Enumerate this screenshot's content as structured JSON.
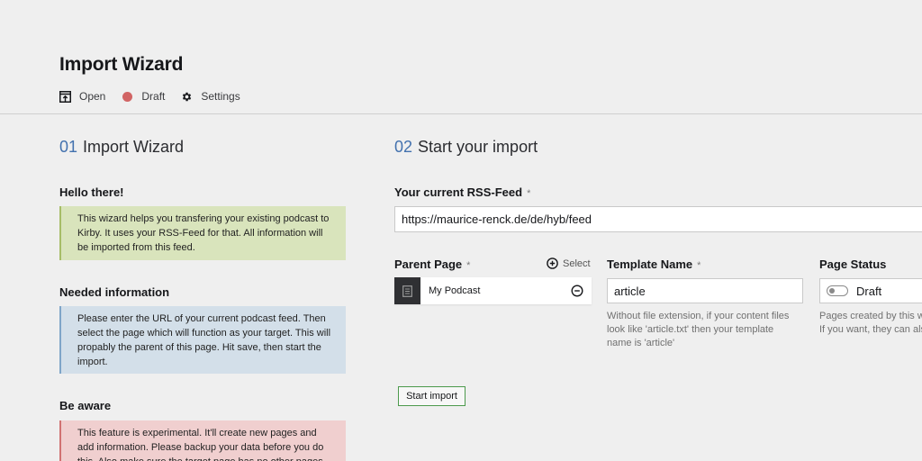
{
  "header": {
    "title": "Import Wizard",
    "toolbar": [
      {
        "label": "Open",
        "icon": "open-icon"
      },
      {
        "label": "Draft",
        "icon": "status-dot-icon",
        "color": "#d16464"
      },
      {
        "label": "Settings",
        "icon": "gear-icon"
      }
    ]
  },
  "left": {
    "number": "01",
    "title": "Import Wizard",
    "sections": [
      {
        "heading": "Hello there!",
        "text": "This wizard helps you transfering your existing podcast to Kirby. It uses your RSS-Feed for that. All information will be imported from this feed."
      },
      {
        "heading": "Needed information",
        "text": "Please enter the URL of your current podcast feed. Then select the page which will function as your target. This will propably the parent of this page. Hit save, then start the import."
      },
      {
        "heading": "Be aware",
        "text": "This feature is experimental. It'll create new pages and add information. Please backup your data before you do this. Also make sure the target page has no other pages"
      }
    ]
  },
  "right": {
    "number": "02",
    "title": "Start your import",
    "rss": {
      "label": "Your current RSS-Feed",
      "required": "*",
      "value": "https://maurice-renck.de/de/hyb/feed"
    },
    "parent": {
      "label": "Parent Page",
      "required": "*",
      "select_label": "Select",
      "item": "My Podcast"
    },
    "template": {
      "label": "Template Name",
      "required": "*",
      "value": "article",
      "help": "Without file extension, if your content files look like 'article.txt' then your template name is 'article'"
    },
    "status": {
      "label": "Page Status",
      "value": "Draft",
      "help_line1": "Pages created by this w",
      "help_line2": "If you want, they can als"
    },
    "start_label": "Start import"
  }
}
